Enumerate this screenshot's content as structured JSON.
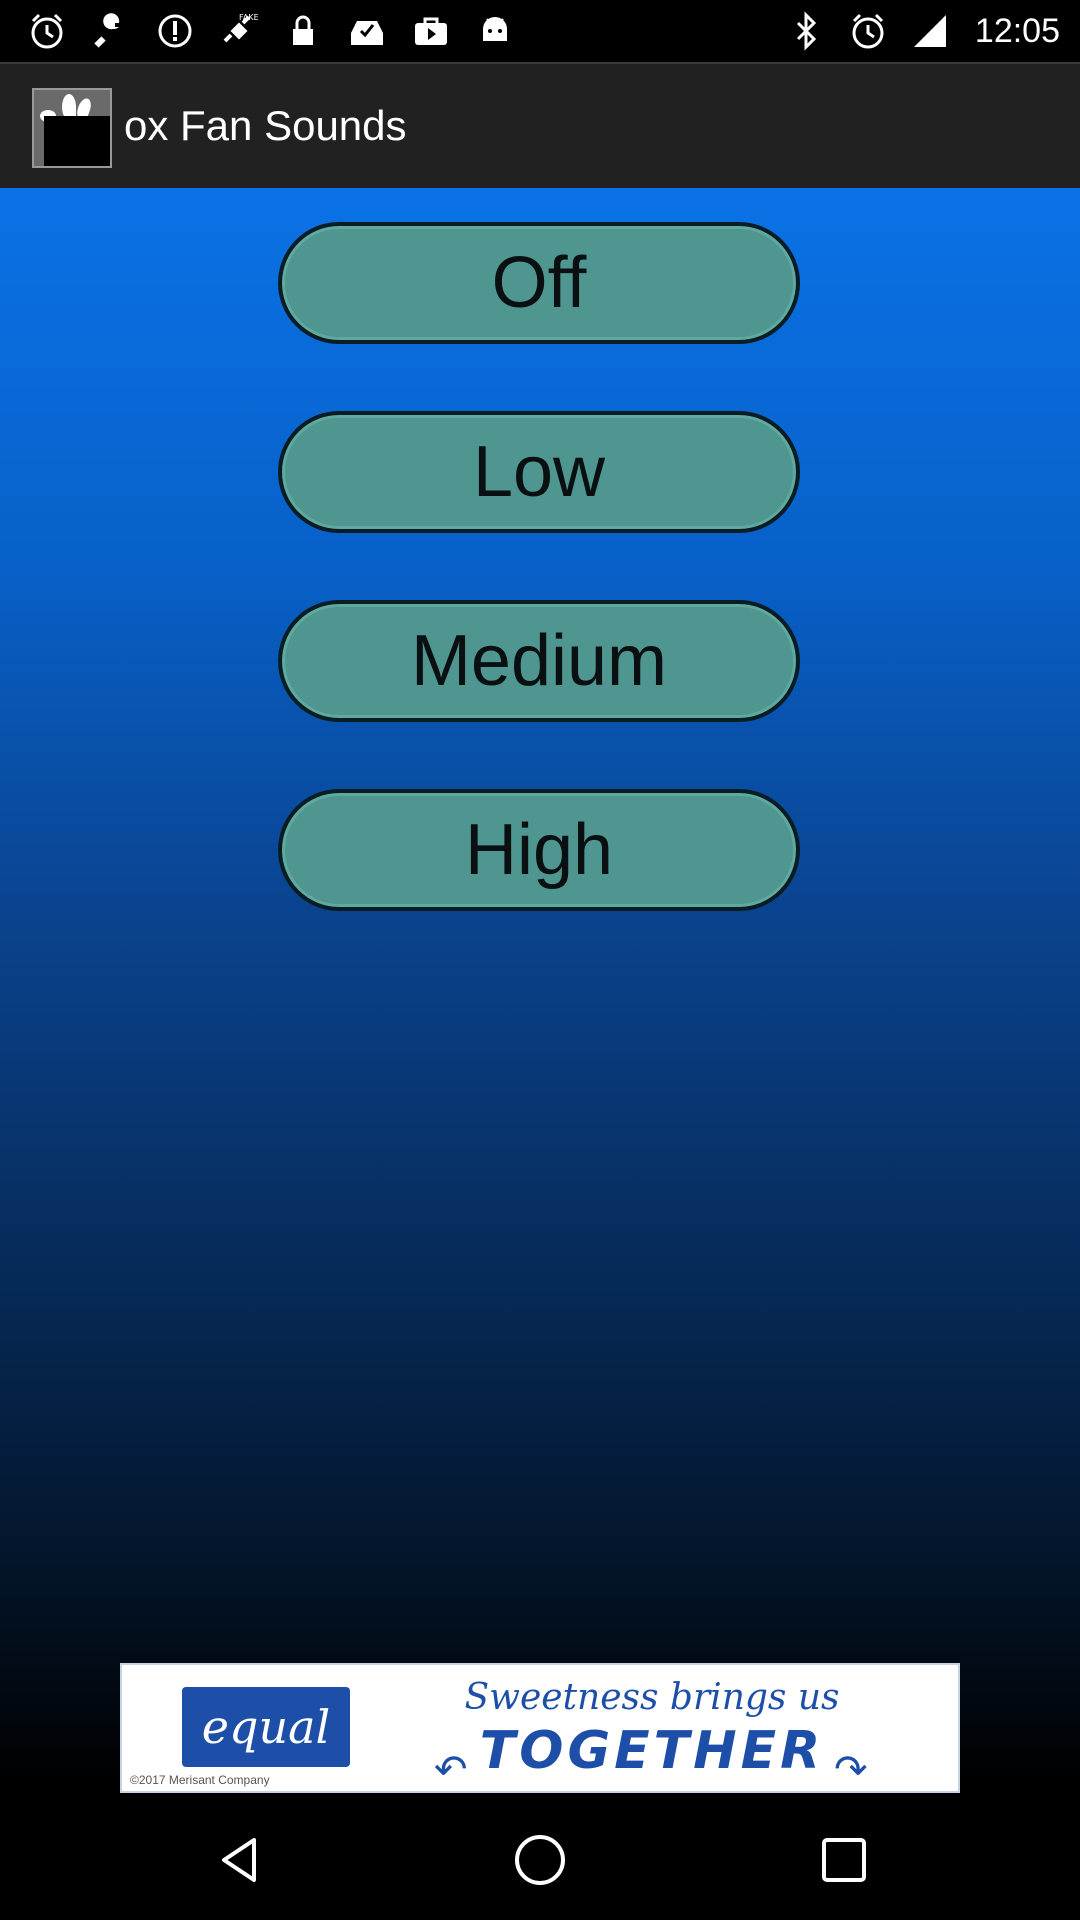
{
  "status_bar": {
    "time": "12:05",
    "left_icons": [
      "alarm-icon",
      "wrench-icon",
      "info-icon",
      "fake-gps-icon",
      "lock-icon",
      "inbox-check-icon",
      "play-store-icon",
      "android-icon"
    ],
    "right_icons": [
      "bluetooth-icon",
      "alarm-icon",
      "signal-icon"
    ]
  },
  "app_bar": {
    "title": "Box Fan Sounds",
    "title_visible": "ox Fan Sounds",
    "bg_color": "#212121"
  },
  "speed_buttons": [
    {
      "label": "Off"
    },
    {
      "label": "Low"
    },
    {
      "label": "Medium"
    },
    {
      "label": "High"
    }
  ],
  "ad": {
    "brand": "equal",
    "copyright": "©2017 Merisant Company",
    "tagline": "Sweetness brings us",
    "headline": "TOGETHER"
  },
  "nav_bar": {
    "buttons": [
      "back-icon",
      "home-icon",
      "recents-icon"
    ]
  },
  "colors": {
    "button_fill": "#4e968f",
    "gradient_top": "#0a72e6",
    "ad_blue": "#1e4fa8"
  }
}
